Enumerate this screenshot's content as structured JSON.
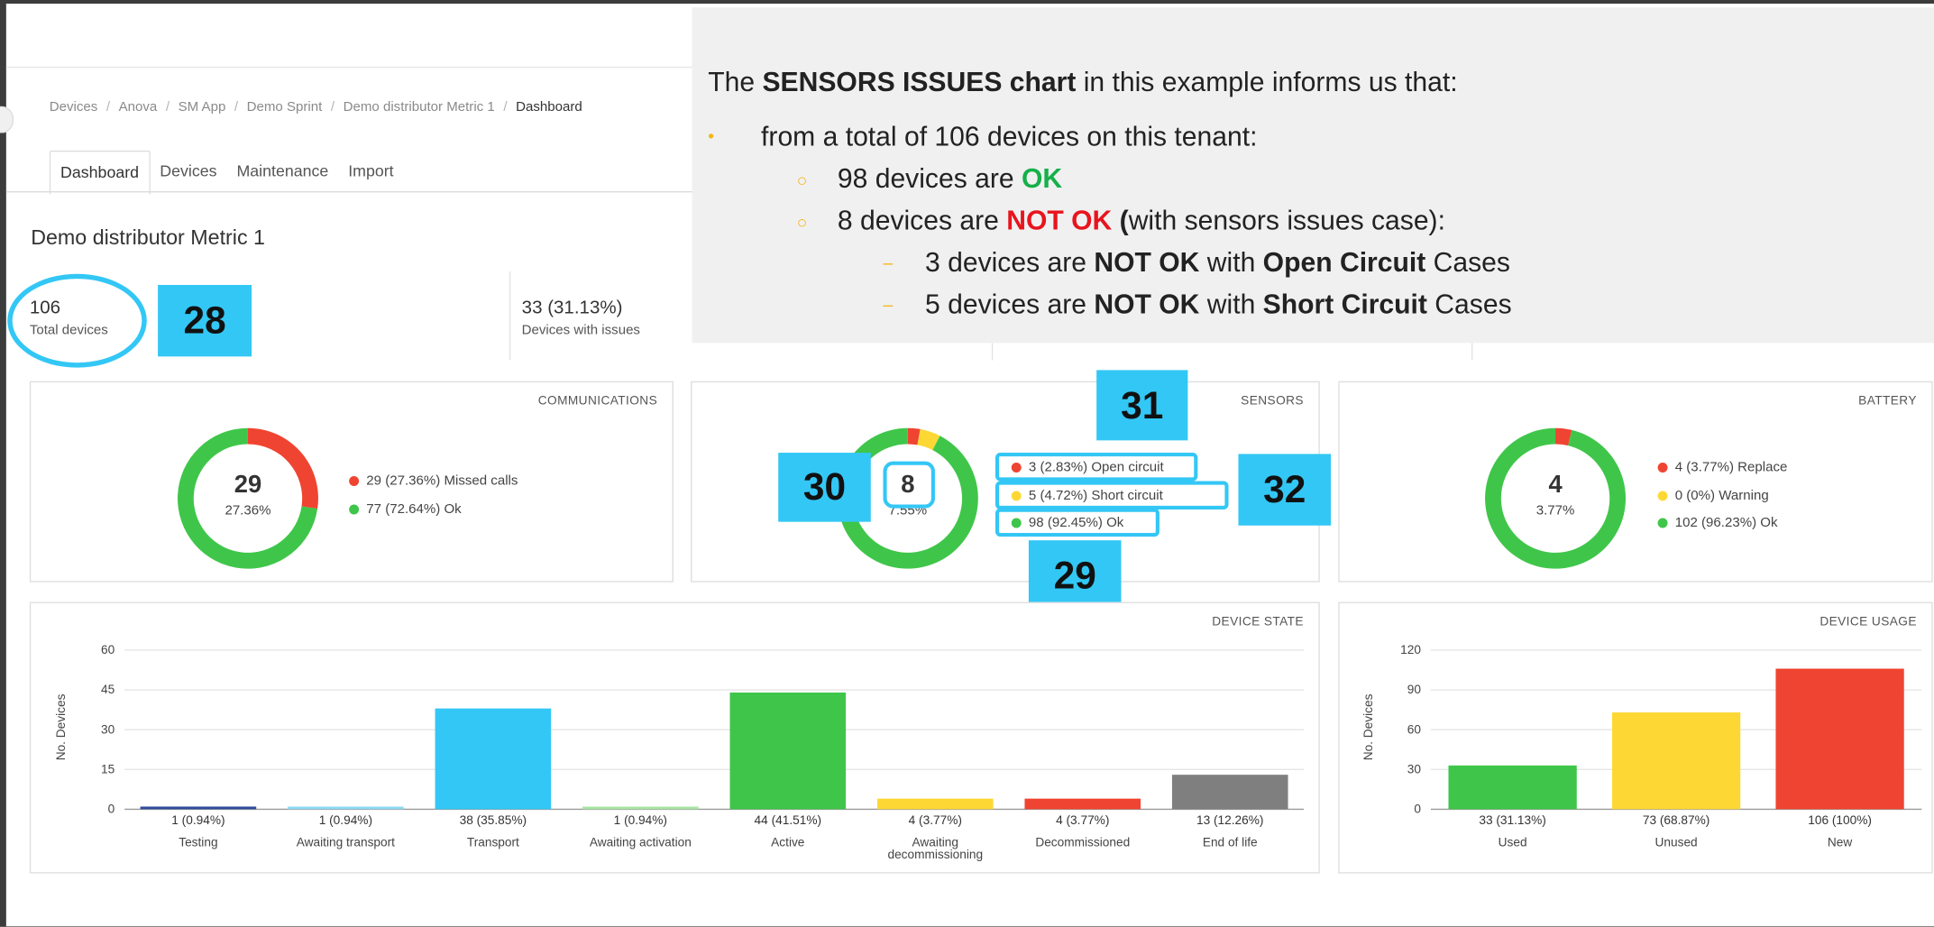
{
  "breadcrumb": [
    "Devices",
    "Anova",
    "SM App",
    "Demo Sprint",
    "Demo distributor Metric 1",
    "Dashboard"
  ],
  "tabs": [
    "Dashboard",
    "Devices",
    "Maintenance",
    "Import"
  ],
  "page_title": "Demo distributor Metric 1",
  "stats": {
    "total_value": "106",
    "total_label": "Total devices",
    "issues_value": "33 (31.13%)",
    "issues_label": "Devices with issues"
  },
  "callouts": {
    "c28": "28",
    "c29": "29",
    "c30": "30",
    "c31": "31",
    "c32": "32"
  },
  "overlay": {
    "line1_pre": "The ",
    "line1_bold": "SENSORS ISSUES chart",
    "line1_post": " in this example informs us that:",
    "line2": "from a total of 106 devices on this tenant:",
    "line3_pre": "98 devices are ",
    "line3_ok": "OK",
    "line4_pre": "8 devices are ",
    "line4_notok": "NOT OK",
    "line4_paren": " (",
    "line4_post": "with sensors issues case):",
    "line5_pre": "3 devices are ",
    "line5_b1": "NOT OK",
    "line5_mid": " with ",
    "line5_b2": "Open Circuit",
    "line5_post": " Cases",
    "line6_pre": "5 devices are ",
    "line6_b1": "NOT OK",
    "line6_mid": " with ",
    "line6_b2": "Short Circuit",
    "line6_post": " Cases",
    "bullet_l1": "•",
    "bullet_l2": "○",
    "bullet_l3": "–"
  },
  "communications": {
    "title": "COMMUNICATIONS",
    "center_value": "29",
    "center_pct": "27.36%",
    "legend": [
      {
        "label": "29 (27.36%) Missed calls",
        "color": "#ef4431"
      },
      {
        "label": "77 (72.64%) Ok",
        "color": "#3fc64a"
      }
    ]
  },
  "sensors": {
    "title": "SENSORS",
    "center_value": "8",
    "center_pct": "7.55%",
    "legend": [
      {
        "label": "3 (2.83%) Open circuit",
        "color": "#ef4431"
      },
      {
        "label": "5 (4.72%) Short circuit",
        "color": "#fdd835"
      },
      {
        "label": "98 (92.45%) Ok",
        "color": "#3fc64a"
      }
    ]
  },
  "battery": {
    "title": "BATTERY",
    "center_value": "4",
    "center_pct": "3.77%",
    "legend": [
      {
        "label": "4 (3.77%) Replace",
        "color": "#ef4431"
      },
      {
        "label": "0 (0%) Warning",
        "color": "#fdd835"
      },
      {
        "label": "102 (96.23%) Ok",
        "color": "#3fc64a"
      }
    ]
  },
  "device_state": {
    "title": "DEVICE STATE",
    "ylabel": "No. Devices"
  },
  "device_usage": {
    "title": "DEVICE USAGE",
    "ylabel": "No. Devices"
  },
  "chart_data": [
    {
      "type": "pie",
      "title": "COMMUNICATIONS",
      "labels": [
        "Missed calls",
        "Ok"
      ],
      "values": [
        29,
        77
      ],
      "colors": [
        "#ef4431",
        "#3fc64a"
      ]
    },
    {
      "type": "pie",
      "title": "SENSORS",
      "labels": [
        "Open circuit",
        "Short circuit",
        "Ok"
      ],
      "values": [
        3,
        5,
        98
      ],
      "colors": [
        "#ef4431",
        "#fdd835",
        "#3fc64a"
      ]
    },
    {
      "type": "pie",
      "title": "BATTERY",
      "labels": [
        "Replace",
        "Warning",
        "Ok"
      ],
      "values": [
        4,
        0,
        102
      ],
      "colors": [
        "#ef4431",
        "#fdd835",
        "#3fc64a"
      ]
    },
    {
      "type": "bar",
      "title": "DEVICE STATE",
      "ylabel": "No. Devices",
      "ylim": [
        0,
        60
      ],
      "yticks": [
        0,
        15,
        30,
        45,
        60
      ],
      "grid": true,
      "categories": [
        "Testing",
        "Awaiting transport",
        "Transport",
        "Awaiting activation",
        "Active",
        "Awaiting decommissioning",
        "Decommissioned",
        "End of life"
      ],
      "values": [
        1,
        1,
        38,
        1,
        44,
        4,
        4,
        13
      ],
      "data_labels": [
        "1 (0.94%)",
        "1 (0.94%)",
        "38 (35.85%)",
        "1 (0.94%)",
        "44 (41.51%)",
        "4 (3.77%)",
        "4 (3.77%)",
        "13 (12.26%)"
      ],
      "colors": [
        "#2f4b9a",
        "#8fd9f5",
        "#33c7f5",
        "#a8e6a3",
        "#3fc64a",
        "#fdd835",
        "#ef4431",
        "#7f7f7f"
      ]
    },
    {
      "type": "bar",
      "title": "DEVICE USAGE",
      "ylabel": "No. Devices",
      "ylim": [
        0,
        120
      ],
      "yticks": [
        0,
        30,
        60,
        90,
        120
      ],
      "grid": true,
      "categories": [
        "Used",
        "Unused",
        "New"
      ],
      "values": [
        33,
        73,
        106
      ],
      "data_labels": [
        "33 (31.13%)",
        "73 (68.87%)",
        "106 (100%)"
      ],
      "colors": [
        "#3fc64a",
        "#fdd835",
        "#ef4431"
      ]
    }
  ]
}
